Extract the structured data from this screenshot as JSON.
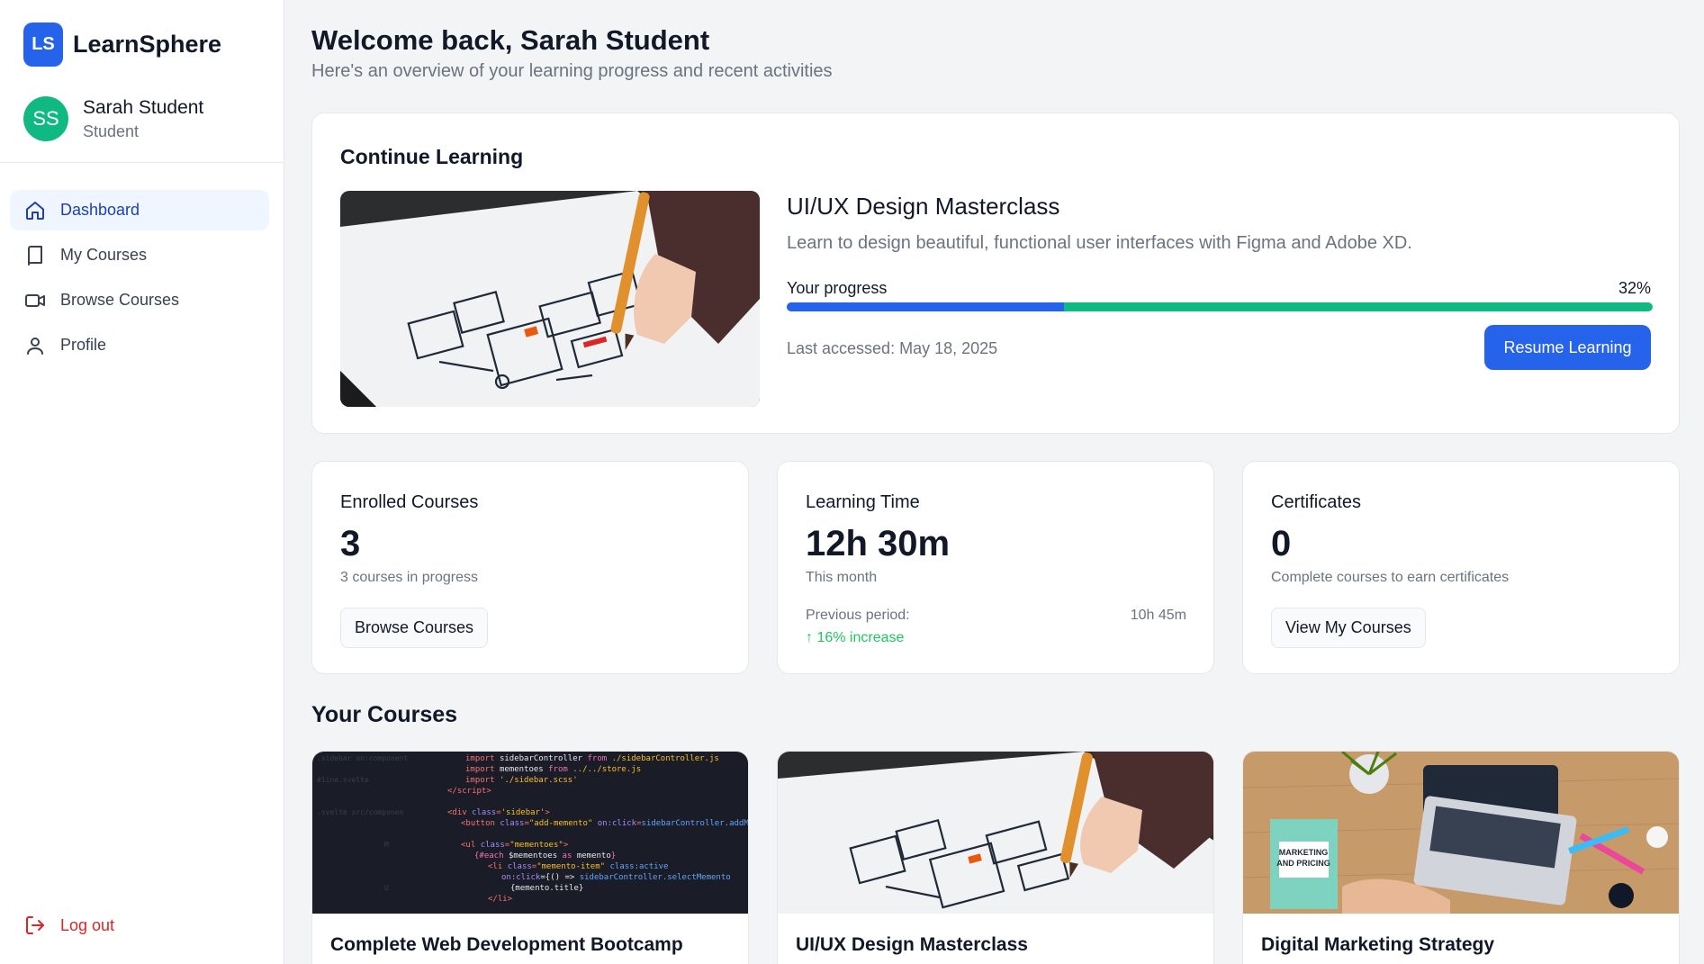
{
  "brand": {
    "logo": "LS",
    "name": "LearnSphere",
    "color": "#2563eb"
  },
  "user": {
    "initials": "SS",
    "name": "Sarah Student",
    "role": "Student",
    "avatar_color": "#10b981"
  },
  "nav": [
    {
      "label": "Dashboard",
      "icon": "home-icon",
      "active": true
    },
    {
      "label": "My Courses",
      "icon": "book-icon",
      "active": false
    },
    {
      "label": "Browse Courses",
      "icon": "video-icon",
      "active": false
    },
    {
      "label": "Profile",
      "icon": "user-icon",
      "active": false
    }
  ],
  "logout": {
    "label": "Log out",
    "icon": "logout-icon"
  },
  "header": {
    "title": "Welcome back, Sarah Student",
    "subtitle": "Here's an overview of your learning progress and recent activities"
  },
  "continue_learning": {
    "title": "Continue Learning",
    "course_name": "UI/UX Design Masterclass",
    "description": "Learn to design beautiful, functional user interfaces with Figma and Adobe XD.",
    "progress_label": "Your progress",
    "progress_text": "32%",
    "progress_fraction": 0.32,
    "last_accessed": "Last accessed: May 18, 2025",
    "resume_label": "Resume Learning"
  },
  "stats": {
    "enrolled": {
      "title": "Enrolled Courses",
      "value": "3",
      "subtitle": "3 courses in progress",
      "button": "Browse Courses"
    },
    "learning_time": {
      "title": "Learning Time",
      "value": "12h 30m",
      "subtitle": "This month",
      "previous_label": "Previous period:",
      "previous_value": "10h 45m",
      "change": "16% increase"
    },
    "certificates": {
      "title": "Certificates",
      "value": "0",
      "subtitle": "Complete courses to earn certificates",
      "button": "View My Courses"
    }
  },
  "your_courses": {
    "title": "Your Courses",
    "items": [
      {
        "title": "Complete Web Development Bootcamp",
        "image": "code-editor-image"
      },
      {
        "title": "UI/UX Design Masterclass",
        "image": "wireframe-sketch-image"
      },
      {
        "title": "Digital Marketing Strategy",
        "image": "desk-laptop-image"
      }
    ]
  }
}
